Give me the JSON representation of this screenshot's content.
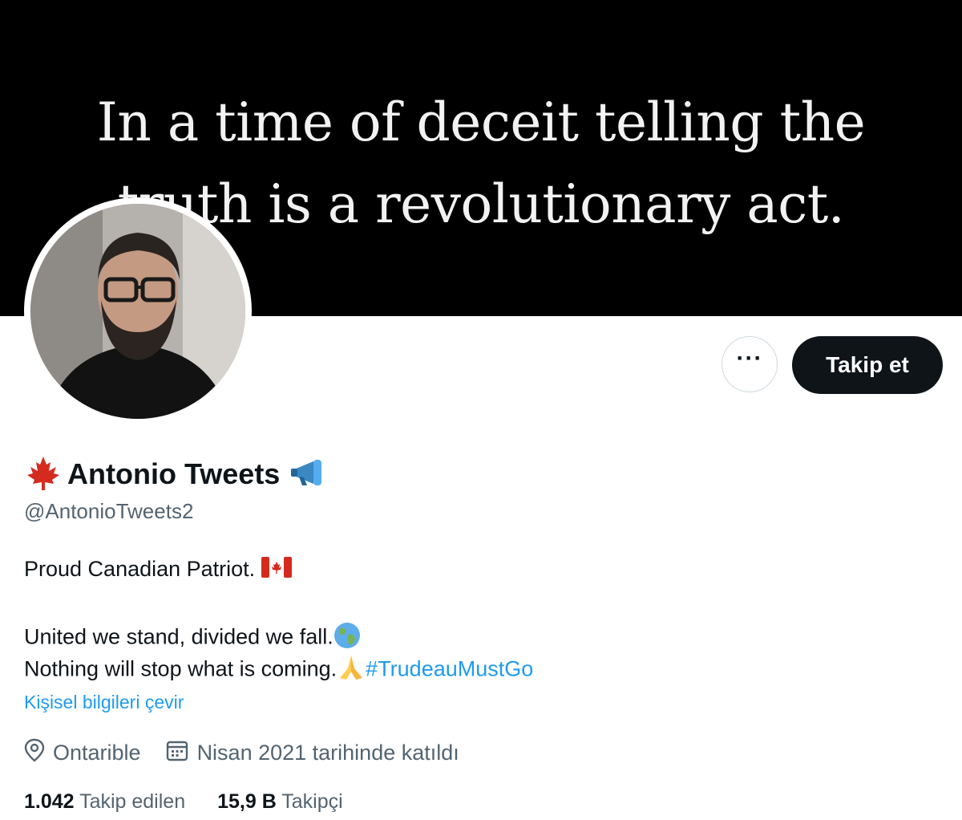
{
  "banner": {
    "quote_line1": "In a time of deceit telling the",
    "quote_line2": "truth is a revolutionary act."
  },
  "actions": {
    "more_label": "···",
    "follow_label": "Takip et"
  },
  "profile": {
    "display_name": "Antonio Tweets",
    "handle": "@AntonioTweets2",
    "bio_line1": "Proud Canadian Patriot.",
    "bio_line2": "United we stand, divided we fall.",
    "bio_line3": "Nothing will stop what is coming.",
    "hashtag": "#TrudeauMustGo",
    "translate_link": "Kişisel bilgileri çevir",
    "location": "Ontarible",
    "joined": "Nisan 2021 tarihinde katıldı",
    "following_count": "1.042",
    "following_label": "Takip edilen",
    "followers_count": "15,9 B",
    "followers_label": "Takipçi"
  },
  "icons": {
    "name_prefix": "maple-leaf-icon",
    "name_suffix": "megaphone-icon",
    "bio_flag": "canada-flag-icon",
    "bio_globe": "globe-icon",
    "bio_hands": "folded-hands-icon",
    "location": "location-pin-icon",
    "calendar": "calendar-icon"
  },
  "colors": {
    "banner": "#000000",
    "follow_button": "#0f1419",
    "link": "#1d9bf0",
    "secondary_text": "#536471",
    "maple_red": "#d52b1e"
  }
}
